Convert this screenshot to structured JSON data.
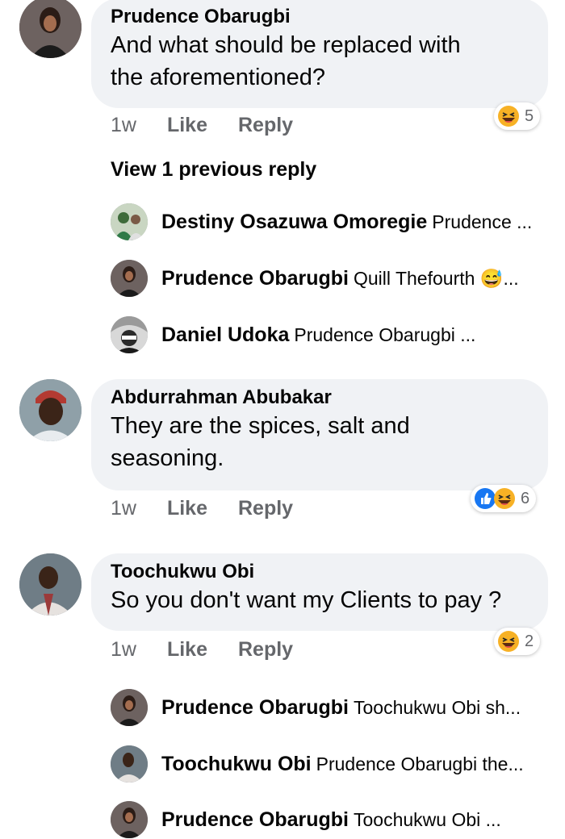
{
  "comments": [
    {
      "author": "Prudence Obarugbi",
      "text_lines": [
        "And what should be replaced with",
        "the aforementioned?"
      ],
      "time": "1w",
      "like": "Like",
      "reply": "Reply",
      "reactions": [
        "laugh"
      ],
      "reaction_count": "5"
    },
    {
      "author": "Abdurrahman Abubakar",
      "text_lines": [
        "They are the spices, salt and",
        "seasoning."
      ],
      "time": "1w",
      "like": "Like",
      "reply": "Reply",
      "reactions": [
        "like",
        "laugh"
      ],
      "reaction_count": "6"
    },
    {
      "author": "Toochukwu Obi",
      "text_lines": [
        "So you don't want my Clients to pay ?"
      ],
      "time": "1w",
      "like": "Like",
      "reply": "Reply",
      "reactions": [
        "laugh"
      ],
      "reaction_count": "2"
    }
  ],
  "view_previous": "View 1 previous reply",
  "replies_1": [
    {
      "name": "Destiny Osazuwa Omoregie",
      "preview": "Prudence ..."
    },
    {
      "name": "Prudence Obarugbi",
      "preview": "Quill Thefourth 😅..."
    },
    {
      "name": "Daniel Udoka",
      "preview": "Prudence Obarugbi ..."
    }
  ],
  "replies_3": [
    {
      "name": "Prudence Obarugbi",
      "preview": "Toochukwu Obi sh..."
    },
    {
      "name": "Toochukwu Obi",
      "preview": "Prudence Obarugbi the..."
    },
    {
      "name": "Prudence Obarugbi",
      "preview": "Toochukwu Obi ..."
    }
  ],
  "colors": {
    "bubble": "#f0f2f5",
    "action_text": "#65676b",
    "like_blue": "#1877f2",
    "laugh_yellow": "#f7b125"
  }
}
